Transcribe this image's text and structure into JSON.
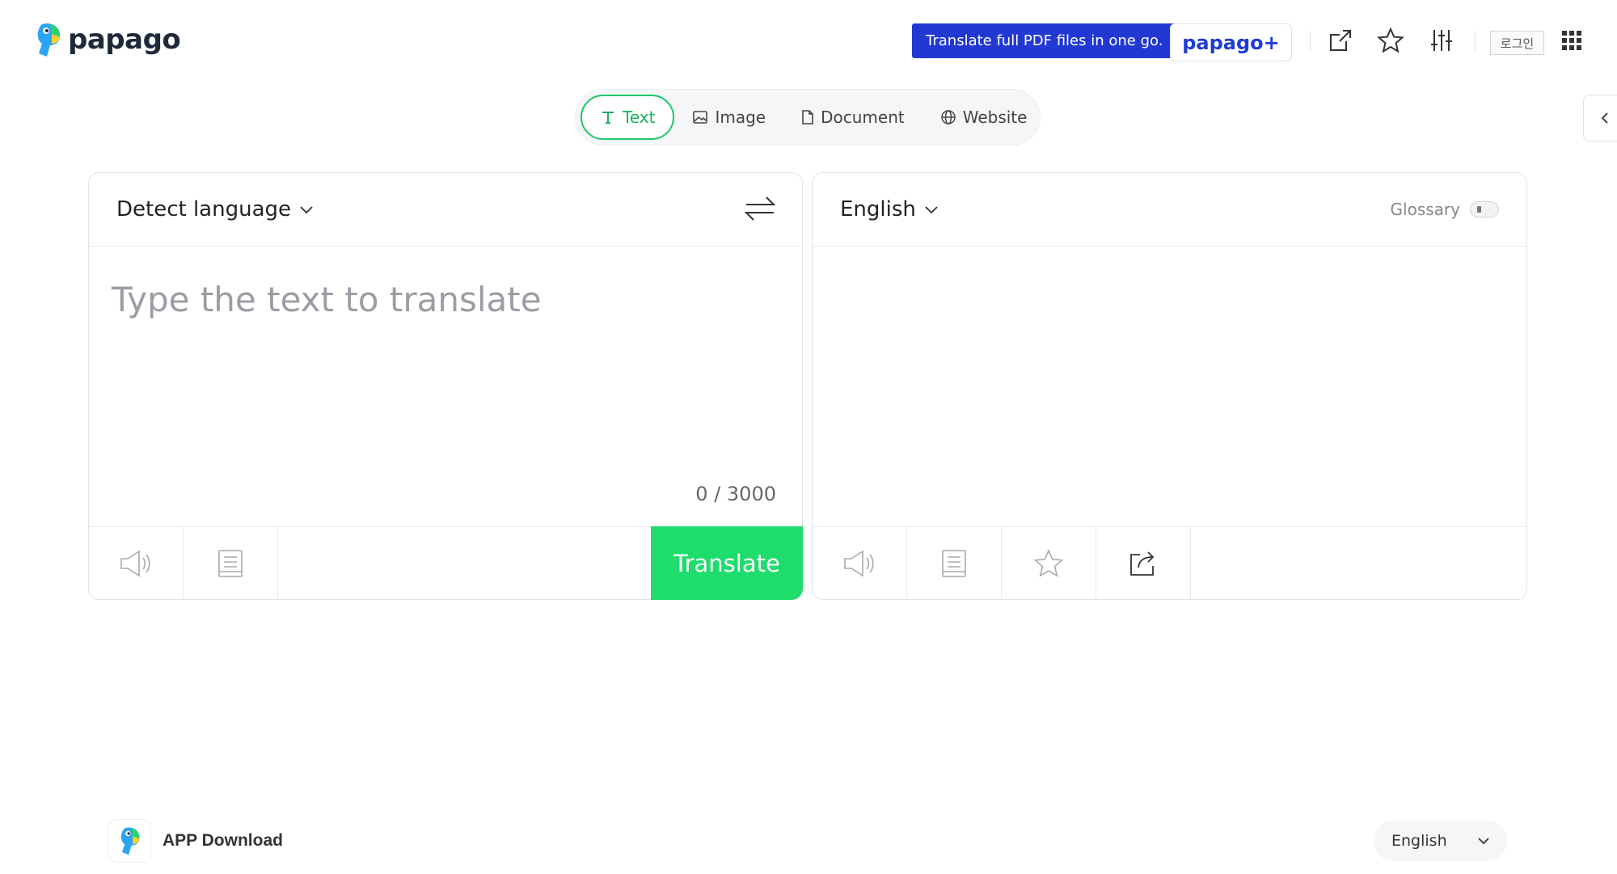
{
  "header": {
    "logo_text": "papago",
    "promo_text": "Translate full PDF files in one go.",
    "plus_label": "papago+",
    "login_label": "로그인",
    "icons": [
      "external-link-icon",
      "star-icon",
      "sliders-icon",
      "grid-icon"
    ]
  },
  "tabs": [
    {
      "label": "Text",
      "icon": "text-icon",
      "active": true
    },
    {
      "label": "Image",
      "icon": "image-icon",
      "active": false
    },
    {
      "label": "Document",
      "icon": "document-icon",
      "active": false
    },
    {
      "label": "Website",
      "icon": "globe-icon",
      "active": false
    }
  ],
  "source": {
    "language": "Detect language",
    "placeholder": "Type the text to translate",
    "counter": "0 / 3000",
    "translate_label": "Translate"
  },
  "target": {
    "language": "English",
    "glossary_label": "Glossary"
  },
  "footer": {
    "app_download": "APP Download",
    "site_language": "English"
  },
  "colors": {
    "accent_green": "#1edd6c",
    "promo_blue": "#2138d3",
    "plus_blue": "#1f3bd6"
  }
}
